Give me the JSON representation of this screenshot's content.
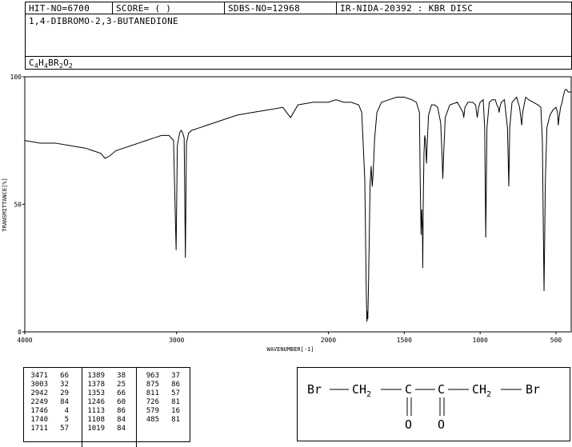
{
  "header": {
    "hit_no": "HIT-NO=6700",
    "score": "SCORE=  (   )",
    "sdbs_no": "SDBS-NO=12968",
    "ir_nida": "IR-NIDA-20392 : KBR DISC",
    "compound_name": "1,4-DIBROMO-2,3-BUTANEDIONE",
    "formula_parts": [
      {
        "t": "C",
        "sub": false
      },
      {
        "t": "4",
        "sub": true
      },
      {
        "t": "H",
        "sub": false
      },
      {
        "t": "4",
        "sub": true
      },
      {
        "t": "BR",
        "sub": false
      },
      {
        "t": "2",
        "sub": true
      },
      {
        "t": "O",
        "sub": false
      },
      {
        "t": "2",
        "sub": true
      }
    ]
  },
  "chart_data": {
    "type": "line",
    "xlabel": "WAVENUMBER[-1]",
    "ylabel": "TRANSMITTANCE[%]",
    "xlim": [
      4000,
      400
    ],
    "ylim": [
      0,
      100
    ],
    "x_ticks": [
      4000,
      3000,
      2000,
      1500,
      1000,
      500
    ],
    "y_ticks": [
      0,
      50,
      100
    ],
    "grid": false,
    "series": [
      {
        "x": [
          4000,
          3900,
          3800,
          3700,
          3600,
          3550,
          3500,
          3471,
          3440,
          3400,
          3350,
          3300,
          3250,
          3200,
          3150,
          3100,
          3050,
          3020,
          3003,
          2995,
          2980,
          2970,
          2960,
          2950,
          2942,
          2935,
          2920,
          2900,
          2850,
          2800,
          2700,
          2600,
          2500,
          2400,
          2300,
          2249,
          2200,
          2100,
          2000,
          1950,
          1900,
          1850,
          1800,
          1780,
          1760,
          1750,
          1746,
          1743,
          1740,
          1735,
          1725,
          1718,
          1711,
          1705,
          1695,
          1680,
          1650,
          1600,
          1550,
          1500,
          1450,
          1420,
          1400,
          1395,
          1389,
          1385,
          1380,
          1378,
          1375,
          1370,
          1365,
          1360,
          1355,
          1353,
          1350,
          1340,
          1320,
          1300,
          1280,
          1260,
          1250,
          1246,
          1240,
          1230,
          1200,
          1150,
          1113,
          1108,
          1100,
          1080,
          1050,
          1030,
          1019,
          1010,
          1000,
          980,
          970,
          963,
          955,
          940,
          920,
          900,
          890,
          880,
          875,
          870,
          860,
          840,
          820,
          811,
          805,
          790,
          760,
          740,
          726,
          720,
          700,
          680,
          650,
          620,
          600,
          590,
          579,
          570,
          560,
          540,
          520,
          500,
          490,
          485,
          480,
          470,
          460,
          450,
          440,
          430,
          420,
          400
        ],
        "y": [
          75,
          74,
          74,
          73,
          72,
          71,
          70,
          68,
          69,
          71,
          72,
          73,
          74,
          75,
          76,
          77,
          77,
          75,
          32,
          73,
          78,
          79,
          78,
          76,
          29,
          74,
          78,
          79,
          80,
          81,
          83,
          85,
          86,
          87,
          88,
          84,
          89,
          90,
          90,
          91,
          90,
          90,
          89,
          86,
          60,
          15,
          4,
          8,
          5,
          20,
          58,
          65,
          57,
          62,
          76,
          86,
          90,
          91,
          92,
          92,
          91,
          90,
          86,
          60,
          38,
          48,
          40,
          25,
          50,
          70,
          77,
          75,
          68,
          66,
          72,
          85,
          89,
          89,
          88,
          82,
          68,
          60,
          70,
          84,
          89,
          90,
          86,
          84,
          88,
          90,
          90,
          89,
          84,
          88,
          90,
          91,
          80,
          37,
          80,
          90,
          91,
          91,
          89,
          88,
          86,
          88,
          90,
          91,
          80,
          57,
          80,
          90,
          92,
          88,
          81,
          86,
          92,
          91,
          90,
          89,
          88,
          75,
          16,
          60,
          80,
          85,
          87,
          88,
          86,
          81,
          84,
          88,
          90,
          93,
          95,
          95,
          94,
          94
        ]
      }
    ]
  },
  "peak_table": {
    "columns": [
      [
        [
          "3471",
          "66"
        ],
        [
          "3003",
          "32"
        ],
        [
          "2942",
          "29"
        ],
        [
          "2249",
          "84"
        ],
        [
          "1746",
          "4"
        ],
        [
          "1740",
          "5"
        ],
        [
          "1711",
          "57"
        ]
      ],
      [
        [
          "1389",
          "38"
        ],
        [
          "1378",
          "25"
        ],
        [
          "1353",
          "66"
        ],
        [
          "1246",
          "60"
        ],
        [
          "1113",
          "86"
        ],
        [
          "1108",
          "84"
        ],
        [
          "1019",
          "84"
        ]
      ],
      [
        [
          "963",
          "37"
        ],
        [
          "875",
          "86"
        ],
        [
          "811",
          "57"
        ],
        [
          "726",
          "81"
        ],
        [
          "579",
          "16"
        ],
        [
          "485",
          "81"
        ]
      ]
    ]
  },
  "structure": {
    "br_left": "Br",
    "ch2_left": "CH",
    "ch2_left_sub": "2",
    "c1": "C",
    "c2": "C",
    "ch2_right": "CH",
    "ch2_right_sub": "2",
    "br_right": "Br",
    "o1": "O",
    "o2": "O"
  }
}
